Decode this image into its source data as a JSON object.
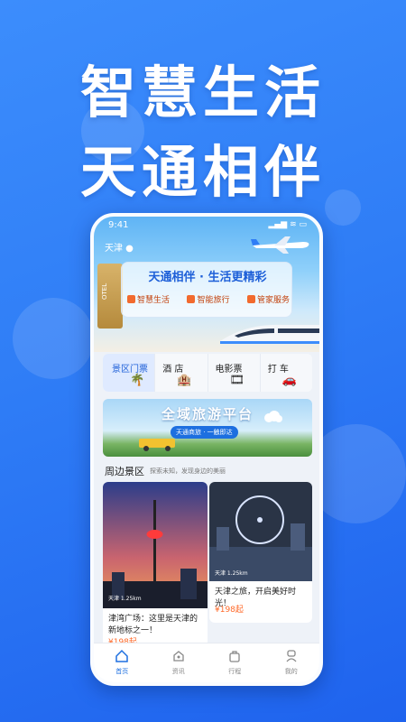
{
  "headline": {
    "line1": "智慧生活",
    "line2": "天通相伴"
  },
  "status": {
    "time": "9:41",
    "icons": "▂▄▆ ≋ ▭"
  },
  "location": "天津 ●",
  "hero": {
    "slogan": "天通相伴 · 生活更精彩",
    "features": [
      "智慧生活",
      "智能旅行",
      "管家服务"
    ],
    "hotel_text": "OTEL"
  },
  "tabs": [
    {
      "label": "景区门票",
      "icon": "palm-tree-icon",
      "glyph": "🌴",
      "active": true
    },
    {
      "label": "酒 店",
      "icon": "hotel-icon",
      "glyph": "🏨",
      "active": false
    },
    {
      "label": "电影票",
      "icon": "film-icon",
      "glyph": "🎞",
      "active": false
    },
    {
      "label": "打 车",
      "icon": "car-icon",
      "glyph": "🚗",
      "active": false
    }
  ],
  "banner": {
    "title": "全域旅游平台",
    "subtitle": "天通商旅 · 一触即达"
  },
  "nearby": {
    "title": "周边景区",
    "subtitle": "探索未知，发现身边的美丽"
  },
  "cards": [
    {
      "location": "天津 1.25km",
      "title": "津湾广场：这里是天津的新地标之一！",
      "price": "¥198起"
    },
    {
      "location": "天津 1.25km",
      "title": "天津之旅，开启美好时光！",
      "price": "¥198起"
    }
  ],
  "nav": [
    {
      "label": "首页",
      "icon": "home-icon",
      "active": true
    },
    {
      "label": "资讯",
      "icon": "news-icon",
      "active": false
    },
    {
      "label": "行程",
      "icon": "luggage-icon",
      "active": false
    },
    {
      "label": "我的",
      "icon": "profile-icon",
      "active": false
    }
  ],
  "colors": {
    "background": "#2f7df6",
    "accent": "#1d6fe0",
    "price": "#ff6a2a"
  }
}
